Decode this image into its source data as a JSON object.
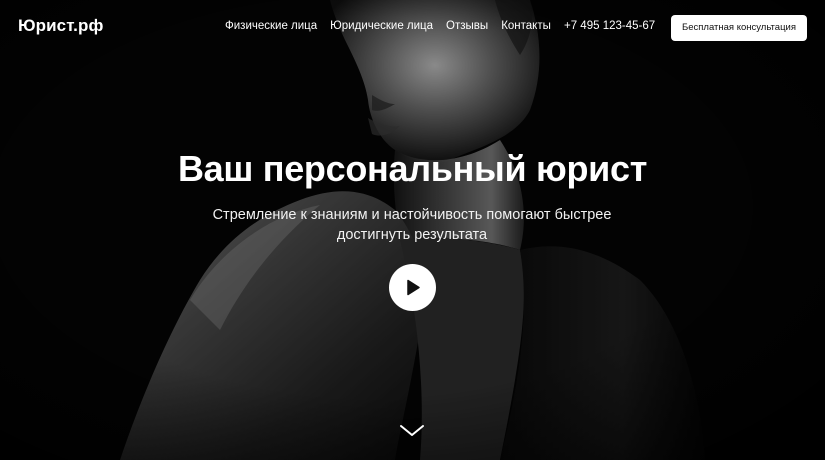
{
  "header": {
    "logo": "Юрист.рф",
    "nav": [
      {
        "label": "Физические лица"
      },
      {
        "label": "Юридические лица"
      },
      {
        "label": "Отзывы"
      },
      {
        "label": "Контакты"
      }
    ],
    "phone": "+7 495 123-45-67",
    "cta_label": "Бесплатная консультация"
  },
  "hero": {
    "title": "Ваш персональный юрист",
    "subtitle": "Стремление к знаниям и настойчивость помогают быстрее достигнуть результата",
    "play_icon": "play-icon",
    "scroll_icon": "chevron-down-icon"
  },
  "colors": {
    "background": "#000000",
    "text": "#ffffff",
    "button_bg": "#ffffff",
    "button_text": "#111111"
  }
}
